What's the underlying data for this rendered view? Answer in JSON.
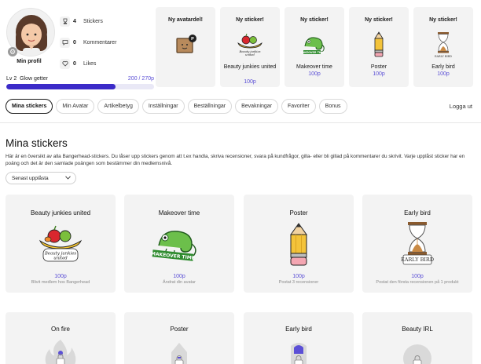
{
  "profile": {
    "name": "Min profil",
    "level": "Lv 2",
    "level_name": "Glow getter",
    "points": "200 / 270p",
    "progress": 0.74,
    "stats": [
      {
        "icon": "trophy-icon",
        "count": "4",
        "label": "Stickers"
      },
      {
        "icon": "comment-icon",
        "count": "0",
        "label": "Kommentarer"
      },
      {
        "icon": "heart-icon",
        "count": "0",
        "label": "Likes"
      }
    ]
  },
  "notifications": [
    {
      "title": "Ny avatardel!",
      "name": "",
      "points": ""
    },
    {
      "title": "Ny sticker!",
      "name": "Beauty junkies united",
      "points": "100p"
    },
    {
      "title": "Ny sticker!",
      "name": "Makeover time",
      "points": "100p"
    },
    {
      "title": "Ny sticker!",
      "name": "Poster",
      "points": "100p"
    },
    {
      "title": "Ny sticker!",
      "name": "Early bird",
      "points": "100p"
    }
  ],
  "tabs": [
    "Mina stickers",
    "Min Avatar",
    "Artikelbetyg",
    "Inställningar",
    "Beställningar",
    "Bevakningar",
    "Favoriter",
    "Bonus"
  ],
  "logout_label": "Logga ut",
  "section": {
    "title": "Mina stickers",
    "description": "Här är en översikt av alla Bangerhead-stickers. Du låser upp stickers genom att t.ex handla, skriva recensioner, svara på kundfrågor, gilla- eller bli gillad på kommentarer du skrivit. Varje upplåst sticker har en poäng och det är den samlade poängen som bestämmer din medlemsnivå.",
    "sort_value": "Senast upplåsta"
  },
  "stickers": [
    {
      "name": "Beauty junkies united",
      "points": "100p",
      "subtitle": "Blivit medlem hos Bangerhead",
      "art_text": [
        "Beauty junkies",
        "united"
      ]
    },
    {
      "name": "Makeover time",
      "points": "100p",
      "subtitle": "Ändrat din avatar",
      "art_text": [
        "MAKEOVER TIME"
      ]
    },
    {
      "name": "Poster",
      "points": "100p",
      "subtitle": "Postat 3 recensioner",
      "art_text": []
    },
    {
      "name": "Early bird",
      "points": "100p",
      "subtitle": "Postat den första recensionen på 1 produkt",
      "art_text": [
        "EARLY",
        "BIRD"
      ]
    }
  ],
  "locked_stickers": [
    {
      "name": "On fire"
    },
    {
      "name": "Poster"
    },
    {
      "name": "Early bird"
    },
    {
      "name": "Beauty IRL"
    }
  ],
  "colors": {
    "accent": "#3b2bc8",
    "points_text": "#5b4fd6",
    "card_bg": "#f3f3f3"
  }
}
